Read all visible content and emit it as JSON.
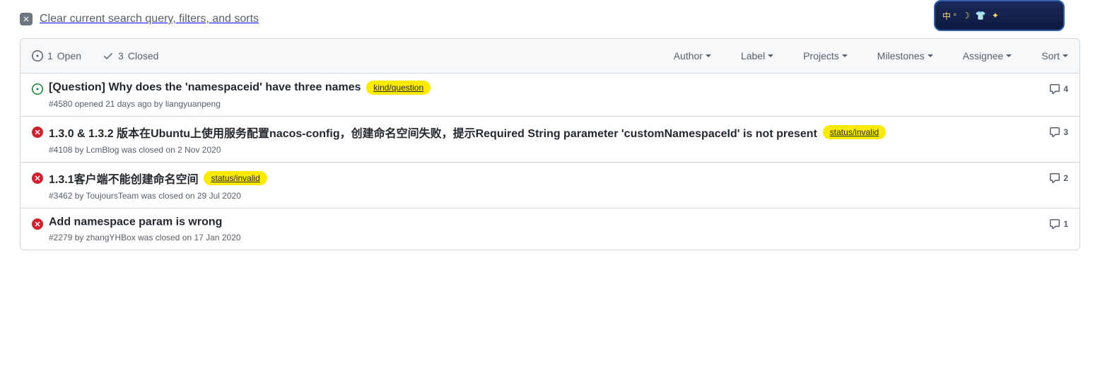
{
  "clear_text": "Clear current search query, filters, and sorts",
  "states": {
    "open": {
      "count": "1",
      "label": "Open"
    },
    "closed": {
      "count": "3",
      "label": "Closed"
    }
  },
  "filters": {
    "author": "Author",
    "label": "Label",
    "projects": "Projects",
    "milestones": "Milestones",
    "assignee": "Assignee",
    "sort": "Sort"
  },
  "issues": [
    {
      "status": "open",
      "title": "[Question] Why does the 'namespaceid' have three names",
      "labels": [
        "kind/question"
      ],
      "meta_prefix": "#4580 opened 21 days ago by ",
      "author": "liangyuanpeng",
      "meta_suffix": "",
      "comments": "4"
    },
    {
      "status": "closed",
      "title": "1.3.0 & 1.3.2 版本在Ubuntu上使用服务配置nacos-config，创建命名空间失败，提示Required String parameter 'customNamespaceId' is not present",
      "labels": [
        "status/invalid"
      ],
      "meta_prefix": "#4108 by ",
      "author": "LcmBlog",
      "meta_suffix": " was closed on 2 Nov 2020",
      "comments": "3"
    },
    {
      "status": "closed",
      "title": "1.3.1客户端不能创建命名空间",
      "labels": [
        "status/invalid"
      ],
      "meta_prefix": "#3462 by ",
      "author": "ToujoursTeam",
      "meta_suffix": " was closed on 29 Jul 2020",
      "comments": "2"
    },
    {
      "status": "closed",
      "title": "Add namespace param is wrong",
      "labels": [],
      "meta_prefix": "#2279 by ",
      "author": "zhangYHBox",
      "meta_suffix": " was closed on 17 Jan 2020",
      "comments": "1"
    }
  ],
  "toy": {
    "text": "中 °"
  }
}
